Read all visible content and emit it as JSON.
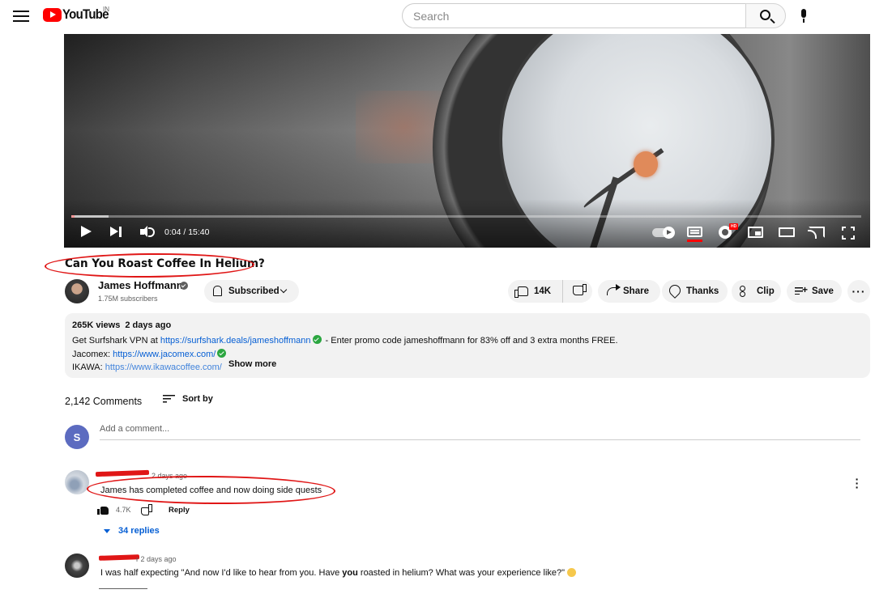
{
  "header": {
    "logo_text": "YouTube",
    "country_code": "IN",
    "search_placeholder": "Search"
  },
  "player": {
    "time_display": "0:04 / 15:40",
    "progress_fraction": 0.004,
    "buffered_fraction": 0.047,
    "hd_badge": "HD",
    "colors": {
      "progress": "#ff0000",
      "captions_underline": "#ff0000"
    }
  },
  "video": {
    "title": "Can You Roast Coffee In Helium?",
    "channel_name": "James Hoffmann",
    "subscribers": "1.75M subscribers",
    "subscribed_label": "Subscribed",
    "like_count": "14K",
    "share_label": "Share",
    "thanks_label": "Thanks",
    "clip_label": "Clip",
    "save_label": "Save",
    "more_label": "···"
  },
  "description": {
    "views": "265K views",
    "date": "2 days ago",
    "line1_prefix": "Get Surfshark VPN at ",
    "line1_link": "https://surfshark.deals/jameshoffmann",
    "line1_suffix": " - Enter promo code jameshoffmann for 83% off and 3 extra months FREE.",
    "line2_prefix": "Jacomex: ",
    "line2_link": "https://www.jacomex.com/",
    "line3_prefix": "IKAWA: ",
    "line3_link": "https://www.ikawacoffee.com/",
    "show_more": "Show more"
  },
  "comments": {
    "count_label": "2,142 Comments",
    "sort_label": "Sort by",
    "my_avatar_letter": "S",
    "add_placeholder": "Add a comment...",
    "items": [
      {
        "time": "2 days ago",
        "text": "James has completed coffee and now doing side quests",
        "likes": "4.7K",
        "reply_label": "Reply",
        "replies_label": "34 replies"
      },
      {
        "time": "r 2 days ago",
        "text_before": "I was half expecting \"And now I'd like to hear from you. Have ",
        "text_bold": "you",
        "text_after": " roasted in helium? What was your experience like?\""
      }
    ]
  },
  "annotations": {
    "circle_color": "#e01616"
  }
}
